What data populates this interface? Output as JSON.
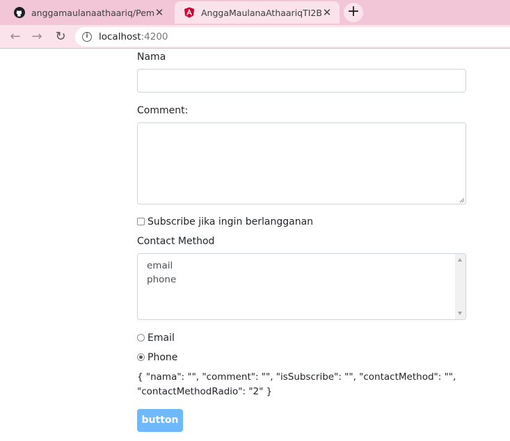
{
  "browser": {
    "tabs": [
      {
        "title": "anggamaulanaathaariq/Pemrogra",
        "icon": "github-icon",
        "active": false
      },
      {
        "title": "AnggaMaulanaAthaariqTI2B",
        "icon": "angular-icon",
        "active": true
      }
    ],
    "url_host": "localhost",
    "url_port": ":4200"
  },
  "form": {
    "nama_label": "Nama",
    "nama_value": "",
    "comment_label": "Comment:",
    "comment_value": "",
    "subscribe_label": "Subscribe jika ingin berlangganan",
    "subscribe_checked": false,
    "contact_method_label": "Contact Method",
    "contact_method_options": [
      "email",
      "phone"
    ],
    "radio_options": [
      {
        "label": "Email",
        "checked": false
      },
      {
        "label": "Phone",
        "checked": true
      }
    ],
    "json_output_line1": "{ \"nama\": \"\", \"comment\": \"\", \"isSubscribe\": \"\", \"contactMethod\": \"\",",
    "json_output_line2": "\"contactMethodRadio\": \"2\" }",
    "button_label": "button"
  },
  "colors": {
    "tabstrip": "#f3c6d7",
    "toolbar": "#fbe3eb",
    "button": "#6fb8fb"
  }
}
